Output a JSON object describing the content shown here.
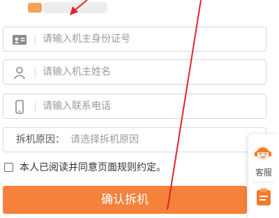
{
  "form": {
    "id_placeholder": "请输入机主身份证号",
    "name_placeholder": "请输入机主姓名",
    "phone_placeholder": "请输入联系电话",
    "reason_label": "拆机原因：",
    "reason_value": "请选择拆机原因",
    "agree_text": "本人已阅读并同意页面规则约定。",
    "agree_checked": false,
    "confirm_label": "确认拆机"
  },
  "side": {
    "service_label": "客服"
  },
  "colors": {
    "accent": "#f5813a",
    "annotation": "#e0242c"
  },
  "icons": [
    "id-card-icon",
    "person-icon",
    "phone-icon",
    "chevron-right-icon",
    "customer-service-icon",
    "clipboard-icon"
  ]
}
